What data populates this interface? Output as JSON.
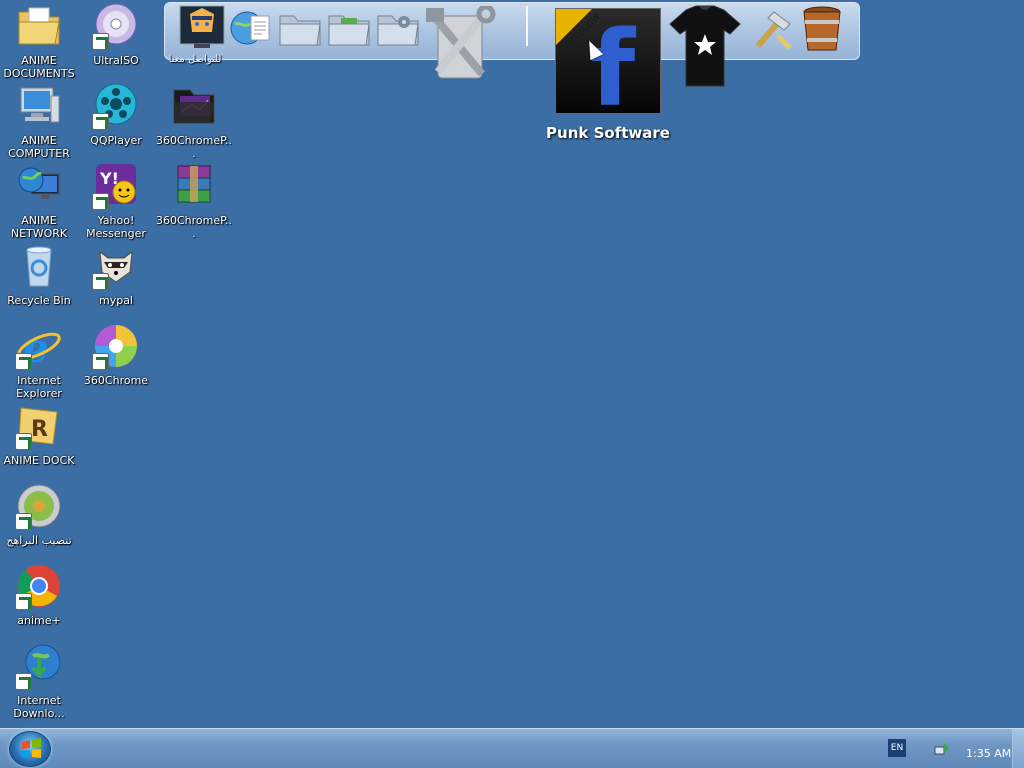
{
  "desktop": {
    "background": "#3b6ea5",
    "icons": [
      {
        "id": "anime-documents",
        "label": "ANIME DOCUMENTS",
        "icon": "folder-documents-icon"
      },
      {
        "id": "anime-computer",
        "label": "ANIME COMPUTER",
        "icon": "computer-icon"
      },
      {
        "id": "anime-network",
        "label": "ANIME NETWORK",
        "icon": "network-globe-icon"
      },
      {
        "id": "recycle-bin",
        "label": "Recycle Bin",
        "icon": "recycle-bin-icon"
      },
      {
        "id": "internet-explorer",
        "label": "Internet Explorer",
        "icon": "internet-explorer-icon"
      },
      {
        "id": "anime-dock",
        "label": "ANIME DOCK",
        "icon": "rocketdock-icon"
      },
      {
        "id": "install-programs",
        "label": "تنصيب البراهج",
        "icon": "install-disc-icon"
      },
      {
        "id": "anime-plus",
        "label": "anime+",
        "icon": "chrome-icon"
      },
      {
        "id": "internet-download",
        "label": "Internet Downlo...",
        "icon": "download-manager-icon"
      },
      {
        "id": "ultraiso",
        "label": "UltraISO",
        "icon": "disc-icon"
      },
      {
        "id": "qqplayer",
        "label": "QQPlayer",
        "icon": "film-reel-icon"
      },
      {
        "id": "yahoo-messenger",
        "label": "Yahoo! Messenger",
        "icon": "yahoo-messenger-icon"
      },
      {
        "id": "mypal",
        "label": "mypal",
        "icon": "raccoon-icon"
      },
      {
        "id": "360chrome",
        "label": "360Chrome",
        "icon": "360-browser-icon"
      },
      {
        "id": "360chrome-folder",
        "label": "360ChromeP...",
        "icon": "dark-folder-icon"
      },
      {
        "id": "360chrome-archive",
        "label": "360ChromeP...",
        "icon": "winrar-archive-icon"
      }
    ]
  },
  "dock": {
    "first_label": "للتواصل معنا",
    "items": [
      "anime-character-icon",
      "globe-document-icon",
      "folder-icon",
      "folder-green-icon",
      "folder-settings-icon",
      "tools-icon",
      "facebook-follow-icon",
      "tshirt-icon",
      "hammer-icon",
      "bucket-icon"
    ],
    "hover_caption": "Punk Software",
    "follow_badge": "FOLLOW",
    "facebook_letter": "f"
  },
  "taskbar": {
    "language": "EN",
    "clock": "1:35 AM"
  }
}
